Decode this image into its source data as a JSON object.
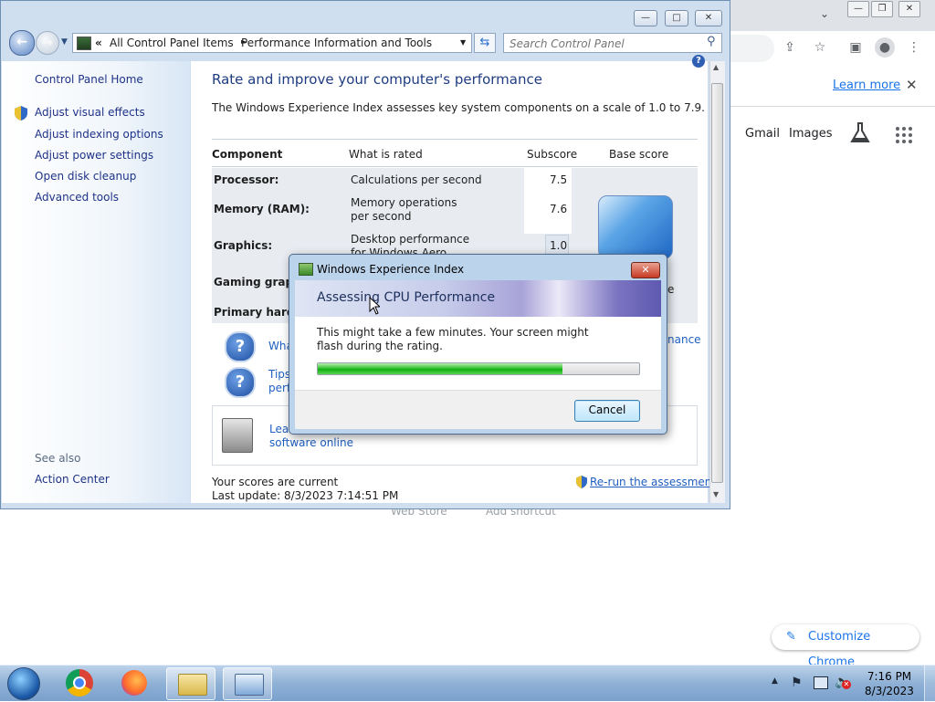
{
  "chrome": {
    "learn_more": "Learn more",
    "close": "✕",
    "gmail": "Gmail",
    "images": "Images",
    "web_store": "Web Store",
    "add_shortcut": "Add shortcut",
    "customize": "Customize Chrome"
  },
  "cp": {
    "breadcrumb": {
      "chevrons": "«",
      "root": "All Control Panel Items",
      "sep": "►",
      "current": "Performance Information and Tools"
    },
    "search_placeholder": "Search Control Panel",
    "left": {
      "home": "Control Panel Home",
      "items": [
        "Adjust visual effects",
        "Adjust indexing options",
        "Adjust power settings",
        "Open disk cleanup",
        "Advanced tools"
      ],
      "see_also": "See also",
      "action_center": "Action Center"
    },
    "title": "Rate and improve your computer's performance",
    "intro": "The Windows Experience Index assesses key system components on a scale of 1.0 to 7.9.",
    "table": {
      "headers": {
        "component": "Component",
        "rated": "What is rated",
        "subscore": "Subscore",
        "base": "Base score"
      },
      "rows": [
        {
          "component": "Processor:",
          "rated": "Calculations per second",
          "subscore": "7.5"
        },
        {
          "component": "Memory (RAM):",
          "rated": "Memory operations per second",
          "subscore": "7.6"
        },
        {
          "component": "Graphics:",
          "rated": "Desktop performance for Windows Aero",
          "subscore": "1.0"
        },
        {
          "component": "Gaming graphics:",
          "rated": "",
          "subscore": ""
        },
        {
          "component": "Primary hard disk:",
          "rated": "",
          "subscore": ""
        }
      ],
      "base_suffix": "e"
    },
    "links": {
      "what": "Wha",
      "right_link": "nance",
      "tips_1": "Tips",
      "tips_2": "perf",
      "learn_1": "Lear",
      "learn_2": "software online"
    },
    "status": {
      "current": "Your scores are current",
      "last_update": "Last update: 8/3/2023 7:14:51 PM",
      "rerun": "Re-run the assessment"
    }
  },
  "dialog": {
    "title": "Windows Experience Index",
    "heading": "Assessing CPU Performance",
    "message": "This might take a few minutes. Your screen might flash during the rating.",
    "progress": 0.76,
    "cancel": "Cancel"
  },
  "taskbar": {
    "time": "7:16 PM",
    "date": "8/3/2023"
  },
  "icons": [
    "start-orb-icon",
    "chrome-icon",
    "firefox-icon",
    "explorer-icon",
    "control-panel-icon",
    "shield-icon",
    "help-icon",
    "flag-icon",
    "network-icon",
    "volume-muted-icon"
  ]
}
